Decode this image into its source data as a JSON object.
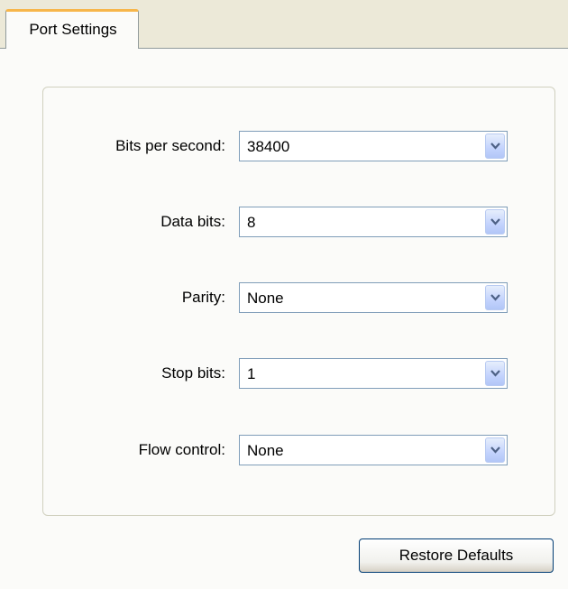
{
  "tabs": [
    {
      "label": "Port Settings",
      "selected": true
    }
  ],
  "settings": {
    "rows": [
      {
        "label": "Bits per second:",
        "value": "38400"
      },
      {
        "label": "Data bits:",
        "value": "8"
      },
      {
        "label": "Parity:",
        "value": "None"
      },
      {
        "label": "Stop bits:",
        "value": "1"
      },
      {
        "label": "Flow control:",
        "value": "None"
      }
    ]
  },
  "actions": {
    "restore_label": "Restore Defaults"
  },
  "icons": {
    "dropdown": "chevron-down-icon"
  },
  "colors": {
    "tab_accent": "#f7b64a",
    "dialog_background": "#ece9d8",
    "field_border": "#7f9db9",
    "dropdown_button": "#c3d3fd"
  }
}
